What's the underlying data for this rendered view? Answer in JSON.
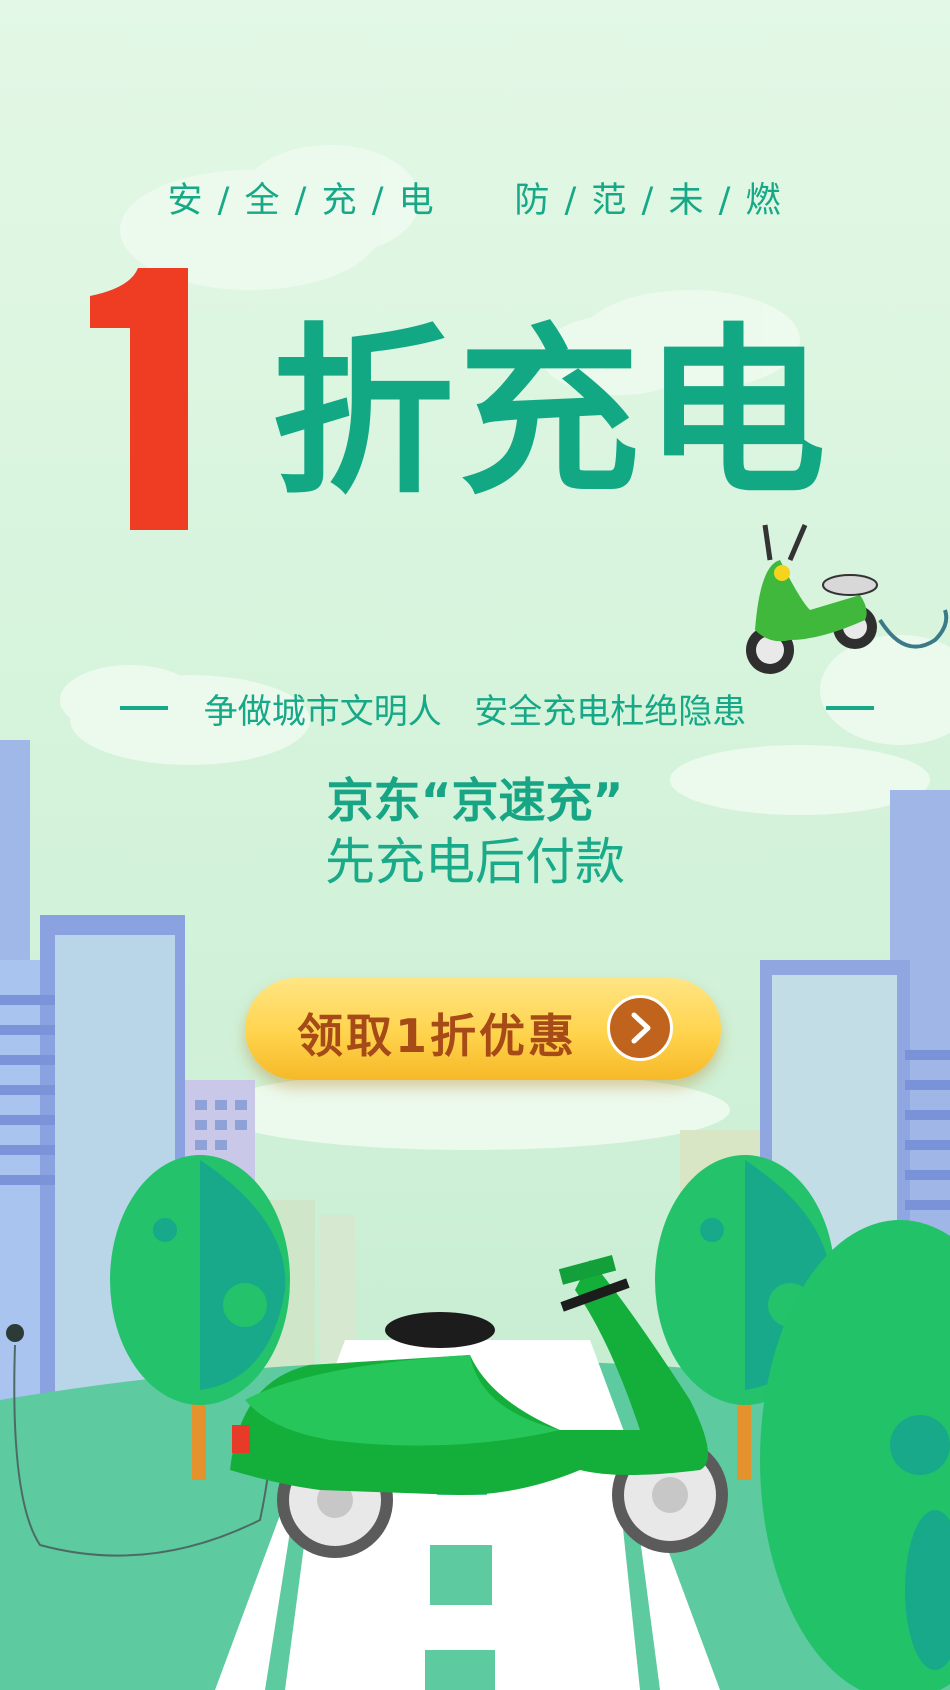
{
  "tagline": "安 / 全 / 充 / 电      防 / 范 / 未 / 燃",
  "headline": {
    "number": "1",
    "text": "折充电"
  },
  "slogan": "争做城市文明人   安全充电杜绝隐患",
  "brand": "京东“京速充”",
  "subtitle": "先充电后付款",
  "cta": {
    "label": "领取1折优惠",
    "icon": "chevron-right-icon"
  },
  "colors": {
    "primary_green": "#13a884",
    "accent_red": "#ee3d22",
    "cta_yellow": "#ffd34c",
    "cta_text": "#a64a17"
  }
}
